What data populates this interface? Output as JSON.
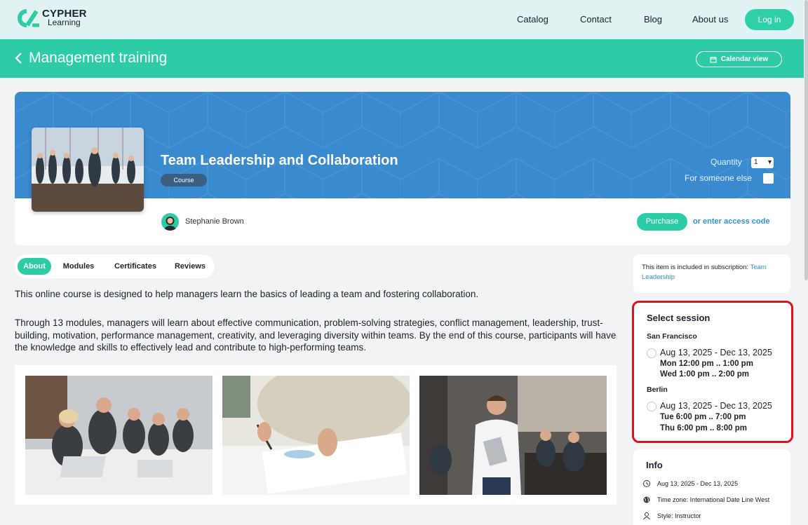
{
  "brand": {
    "line1": "CYPHER",
    "line2": "Learning"
  },
  "nav": {
    "items": [
      "Catalog",
      "Contact",
      "Blog",
      "About us"
    ],
    "login": "Log in"
  },
  "header": {
    "title": "Management training",
    "calendar_view": "Calendar view"
  },
  "course": {
    "title": "Team Leadership and Collaboration",
    "badge": "Course",
    "quantity_label": "Quantity",
    "quantity_value": "1",
    "for_someone_else": "For someone else",
    "instructor": "Stephanie Brown",
    "purchase": "Purchase",
    "access_code": "or enter access code"
  },
  "tabs": [
    "About",
    "Modules",
    "Certificates",
    "Reviews"
  ],
  "about": {
    "p1": "This online course is designed to help managers learn the basics of leading a team and fostering collaboration.",
    "p2": "Through 13 modules, managers will learn about effective communication, problem-solving strategies, conflict management, leadership, trust-building, motivation, performance management, creativity, and leveraging diversity within teams. By the end of this course, participants will have the knowledge and skills to effectively lead and contribute to high-performing teams."
  },
  "subscription": {
    "text": "This item is included in subscription: ",
    "link": "Team Leadership"
  },
  "session": {
    "title": "Select session",
    "groups": [
      {
        "city": "San Francisco",
        "range": "Aug 13, 2025 - Dec 13, 2025",
        "slots": [
          "Mon 12:00 pm .. 1:00 pm",
          "Wed 1:00 pm .. 2:00 pm"
        ]
      },
      {
        "city": "Berlin",
        "range": "Aug 13, 2025 - Dec 13, 2025",
        "slots": [
          "Tue 6:00 pm .. 7:00 pm",
          "Thu 6:00 pm .. 8:00 pm"
        ]
      }
    ]
  },
  "info": {
    "title": "Info",
    "rows": [
      {
        "icon": "clock-icon",
        "text": "Aug 13, 2025 - Dec 13, 2025"
      },
      {
        "icon": "globe-icon",
        "text": "Time zone: International Date Line West"
      },
      {
        "icon": "person-icon",
        "text": "Style: Instructor"
      }
    ]
  },
  "colors": {
    "accent": "#2ecca6",
    "banner": "#3a8ad0",
    "link": "#2f8fd8",
    "highlight": "#e3101a"
  }
}
